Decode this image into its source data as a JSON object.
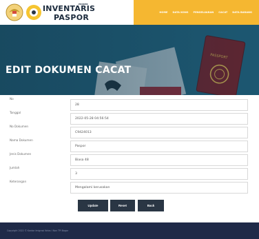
{
  "header": {
    "brand_small": "PROKER",
    "brand_line1": "INVENTARIS",
    "brand_line2": "PASPOR"
  },
  "nav": {
    "items": [
      "HOME",
      "DATA KONS",
      "PENGELUARAN",
      "CACAT",
      "DATA BARANG"
    ]
  },
  "page": {
    "title": "EDIT DOKUMEN CACAT"
  },
  "form": {
    "fields": [
      {
        "label": "No",
        "value": "28"
      },
      {
        "label": "Tanggal",
        "value": "2022-05-28 04:56:54"
      },
      {
        "label": "No Dokumen",
        "value": "C9424013"
      },
      {
        "label": "Nama Dokumen",
        "value": "Paspor"
      },
      {
        "label": "Jenis Dokumen",
        "value": "Biasa 48"
      },
      {
        "label": "Jumlah",
        "value": "3"
      },
      {
        "label": "Keterangan",
        "value": "Mengalami kerusakan"
      }
    ]
  },
  "buttons": {
    "update": "Update",
    "reset": "Reset",
    "back": "Back"
  },
  "footer": {
    "text": "Copyright 2022 © Kantor Imigrasi Kelas I Non TPI Bogor"
  },
  "colors": {
    "nav_bg": "#f5b731",
    "hero_bg": "#1e5a74",
    "button_bg": "#2a3644",
    "footer_bg": "#1f2a48"
  }
}
